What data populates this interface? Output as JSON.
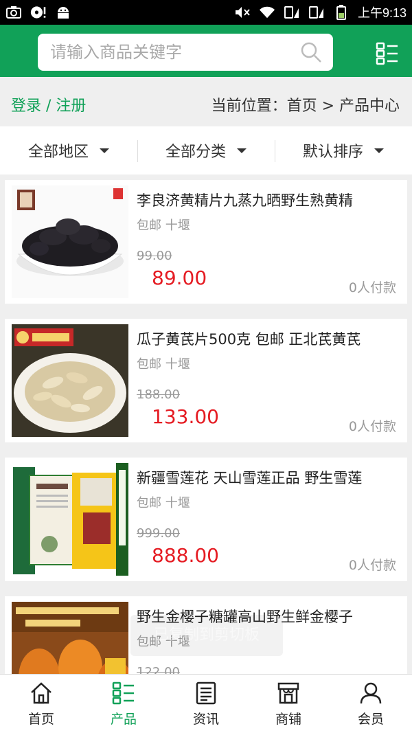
{
  "status_bar": {
    "time": "上午9:13"
  },
  "header": {
    "search_placeholder": "请输入商品关键字",
    "accent_color": "#11a158"
  },
  "breadcrumb": {
    "login_label": "登录 / 注册",
    "location": "当前位置：首页 > 产品中心"
  },
  "filters": [
    {
      "label": "全部地区"
    },
    {
      "label": "全部分类"
    },
    {
      "label": "默认排序"
    }
  ],
  "products": [
    {
      "title": "李良济黄精片九蒸九晒野生熟黄精",
      "subtitle": "包邮 十堰",
      "old_price": "99.00",
      "price": "89.00",
      "paid": "0人付款"
    },
    {
      "title": "瓜子黄芪片500克 包邮 正北芪黄芪",
      "subtitle": "包邮 十堰",
      "old_price": "188.00",
      "price": "133.00",
      "paid": "0人付款"
    },
    {
      "title": "新疆雪莲花 天山雪莲正品 野生雪莲",
      "subtitle": "包邮 十堰",
      "old_price": "999.00",
      "price": "888.00",
      "paid": "0人付款"
    },
    {
      "title": "野生金樱子糖罐高山野生鲜金樱子",
      "subtitle": "包邮 十堰",
      "old_price": "122.00",
      "price": "",
      "paid": ""
    }
  ],
  "toast": {
    "text": "已复制到剪切板"
  },
  "bottom_nav": [
    {
      "label": "首页",
      "icon": "home-icon"
    },
    {
      "label": "产品",
      "icon": "grid-list-icon",
      "active": true
    },
    {
      "label": "资讯",
      "icon": "news-icon"
    },
    {
      "label": "商铺",
      "icon": "store-icon"
    },
    {
      "label": "会员",
      "icon": "user-icon"
    }
  ]
}
